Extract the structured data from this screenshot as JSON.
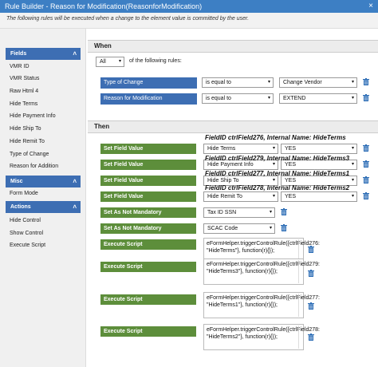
{
  "titlebar": {
    "title": "Rule Builder - Reason for Modification(ReasonforModification)",
    "close": "×"
  },
  "subtitle": "The following rules will be executed when a change to the element value is committed by the user.",
  "sidebar": {
    "fields_header": "Fields",
    "fields": [
      "VMR ID",
      "VMR Status",
      "Raw Html 4",
      "Hide Terms",
      "Hide Payment Info",
      "Hide Ship To",
      "Hide Remit To",
      "Type of Change",
      "Reason for Addition"
    ],
    "misc_header": "Misc",
    "misc": [
      "Form Mode"
    ],
    "actions_header": "Actions",
    "actions": [
      "Hide Control",
      "Show Control",
      "Execute Script"
    ]
  },
  "when": {
    "heading": "When",
    "quantifier": "All",
    "of_rules": "of the following rules:",
    "rules": [
      {
        "field": "Type of Change",
        "operator": "is equal to",
        "value": "Change Vendor"
      },
      {
        "field": "Reason for Modification",
        "operator": "is equal to",
        "value": "EXTEND"
      }
    ]
  },
  "then": {
    "heading": "Then",
    "actions": [
      {
        "action": "Set Field Value",
        "target": "Hide Terms",
        "value": "YES"
      },
      {
        "action": "Set Field Value",
        "target": "Hide Payment Info",
        "value": "YES"
      },
      {
        "action": "Set Field Value",
        "target": "Hide Ship To",
        "value": "YES"
      },
      {
        "action": "Set Field Value",
        "target": "Hide Remit To",
        "value": "YES"
      },
      {
        "action": "Set As Not Mandatory",
        "target": "Tax ID SSN"
      },
      {
        "action": "Set As Not Mandatory",
        "target": "SCAC Code"
      }
    ],
    "scripts": [
      {
        "action": "Execute Script",
        "code": "eFormHelper.triggerControlRule({ctrlField276: \"HideTerms\"}, function(r){});"
      },
      {
        "action": "Execute Script",
        "code": "eFormHelper.triggerControlRule({ctrlField279: \"HideTerms3\"}, function(r){});"
      },
      {
        "action": "Execute Script",
        "code": "eFormHelper.triggerControlRule({ctrlField277: \"HideTerms1\"}, function(r){});"
      },
      {
        "action": "Execute Script",
        "code": "eFormHelper.triggerControlRule({ctrlField278: \"HideTerms2\"}, function(r){});"
      }
    ]
  },
  "annotations": [
    "FieldID ctrlField276, Internal Name: HideTerms",
    "FieldID ctrlField279, Internal Name: HideTerms3",
    "FieldID ctrlField277, Internal Name: HideTerms1",
    "FieldID ctrlField278, Internal Name: HideTerms2"
  ],
  "icons": {
    "trash": "trash-icon",
    "caret": "▾",
    "chevron": "˄"
  }
}
